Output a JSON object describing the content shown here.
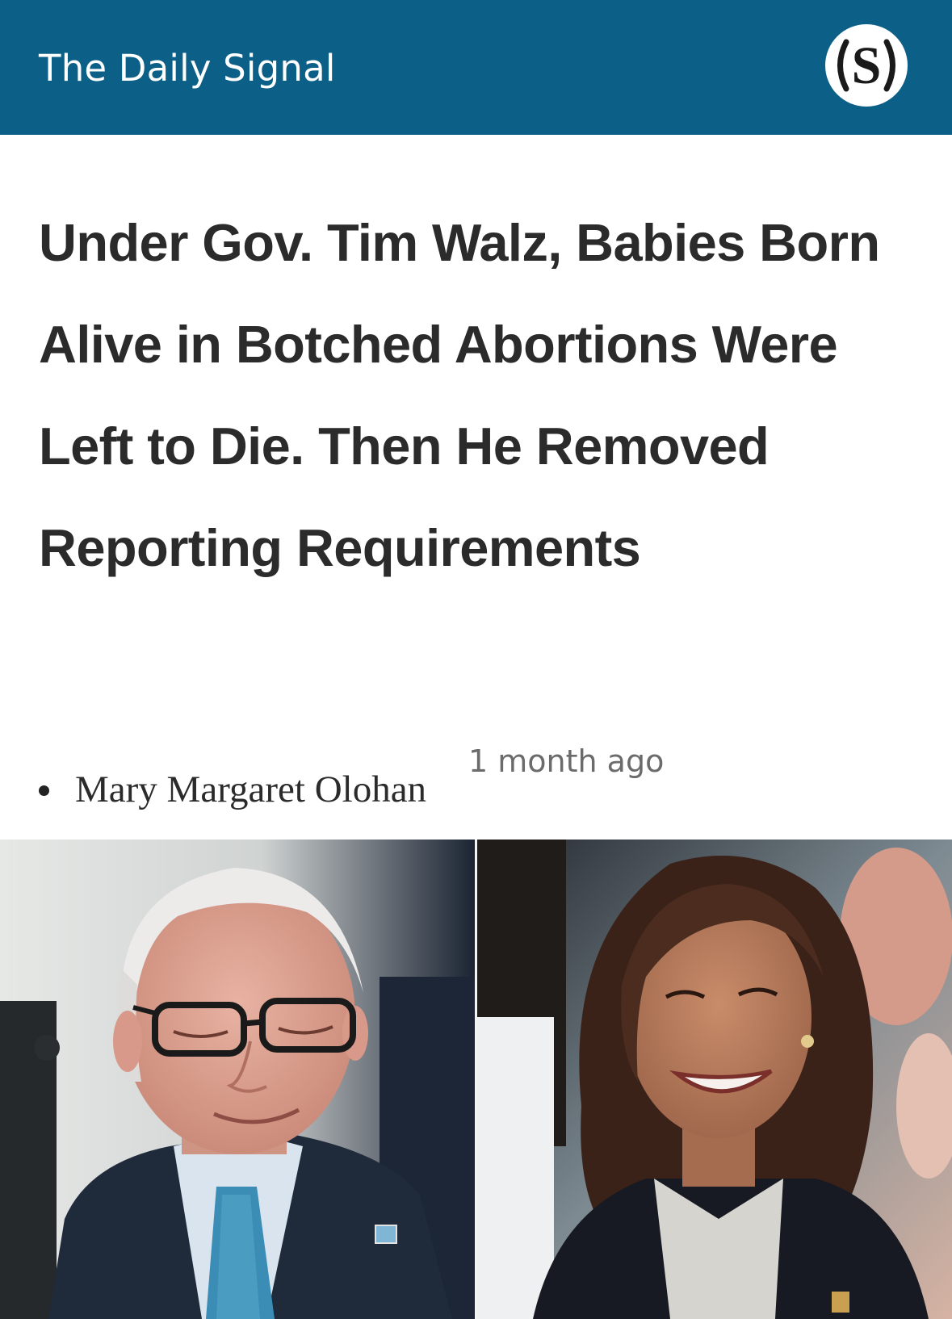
{
  "header": {
    "site_name": "The Daily Signal",
    "logo_icon": "daily-signal-s-logo-icon",
    "logo_glyph": "S",
    "background_color": "#0c5f86"
  },
  "article": {
    "headline": "Under Gov. Tim Walz, Babies Born Alive in Botched Abortions Were Left to Die. Then He Removed Reporting Requirements",
    "author": "Mary Margaret Olohan",
    "published": "1 month ago",
    "hero_image": {
      "panels": [
        "tim-walz-photo",
        "kamala-harris-photo"
      ]
    }
  },
  "colors": {
    "headline_text": "#2b2b2b",
    "meta_text": "#6b6b6b"
  }
}
